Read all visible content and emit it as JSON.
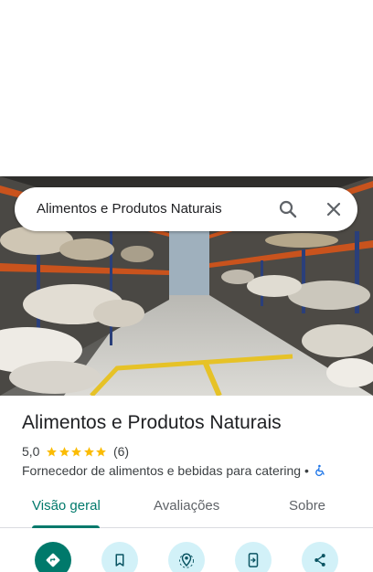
{
  "search": {
    "query": "Alimentos e Produtos Naturais"
  },
  "place": {
    "name": "Alimentos e Produtos Naturais",
    "rating": "5,0",
    "stars": 5,
    "review_count": "(6)",
    "category": "Fornecedor de alimentos e bebidas para catering •"
  },
  "tabs": [
    {
      "label": "Visão geral",
      "active": true
    },
    {
      "label": "Avaliações",
      "active": false
    },
    {
      "label": "Sobre",
      "active": false
    }
  ],
  "actions": [
    {
      "icon": "directions-icon",
      "primary": true
    },
    {
      "icon": "bookmark-icon",
      "primary": false
    },
    {
      "icon": "nearby-icon",
      "primary": false
    },
    {
      "icon": "send-to-phone-icon",
      "primary": false
    },
    {
      "icon": "share-icon",
      "primary": false
    }
  ],
  "colors": {
    "accent": "#00796b",
    "star": "#fbbc04",
    "action_bg": "#d2f1f8",
    "accessibility": "#1a73e8"
  }
}
